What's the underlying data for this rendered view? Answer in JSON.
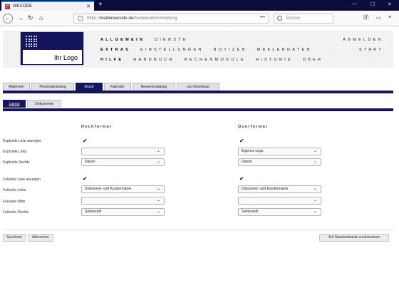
{
  "browser": {
    "tab_title": "WECODE",
    "tab_close": "✕",
    "new_tab": "+",
    "win_min": "—",
    "win_max": "☐",
    "win_close": "✕",
    "back": "←",
    "forward": "→",
    "reload": "↻",
    "home": "⌂",
    "url_prefix": "https://",
    "url_domain": "maklerwecode.de",
    "url_path": "/framework/Anmeldung",
    "url_more": "•••",
    "search_placeholder": "Suchen",
    "library": "|||\\",
    "sidebar": "▭",
    "menu": "≡",
    "icons": {
      "back": "back-arrow-icon",
      "forward": "forward-arrow-icon",
      "reload": "reload-icon",
      "home": "home-icon",
      "search": "search-icon",
      "info": "info-icon"
    }
  },
  "header": {
    "logo_text": "Ihr Logo",
    "menu": [
      {
        "title": "ALLGEMEIN",
        "items": [
          "DIENSTE"
        ],
        "right": "ABMELDEN"
      },
      {
        "title": "EXTRAS",
        "items": [
          "EINSTELLUNGEN",
          "NOTIZEN",
          "MAKLERDATEN"
        ],
        "right": "START"
      },
      {
        "title": "HILFE",
        "items": [
          "HANDBUCH",
          "RECHENMODULE",
          "HISTORIE",
          "ÜBER"
        ],
        "right": ""
      }
    ]
  },
  "tabs": [
    "Allgemein",
    "Personalisierung",
    "Druck",
    "Kalender",
    "Newsverwaltung",
    "Up-/Download"
  ],
  "active_tab": "Druck",
  "subtabs": [
    "Layout",
    "Dokumente"
  ],
  "active_subtab": "Layout",
  "form": {
    "col_hochformat": "Hochformat",
    "col_querformat": "Querformat",
    "rows": {
      "kopf_check": "Kopfzeile Linie anzeigen",
      "kopf_links": "Kopfzeile Links",
      "kopf_rechts": "Kopfzeile Rechts",
      "fuss_check": "Fußzeile Linie anzeigen",
      "fuss_links": "Fußzeile Links",
      "fuss_mitte": "Fußzeile Mitte",
      "fuss_rechts": "Fußzeile Rechts"
    },
    "hoch": {
      "kopf_check": "✔",
      "kopf_links": "",
      "kopf_rechts": "Datum",
      "fuss_check": "✔",
      "fuss_links": "Dokument- und Kundenname",
      "fuss_mitte": "",
      "fuss_rechts": "Seitenzahl"
    },
    "quer": {
      "kopf_check": "✔",
      "kopf_links": "Eigenes Logo",
      "kopf_rechts": "Datum",
      "fuss_check": "✔",
      "fuss_links": "Dokument- und Kundenname",
      "fuss_mitte": "",
      "fuss_rechts": "Seitenzahl"
    },
    "chevron": "⌄"
  },
  "buttons": {
    "save": "Speichern",
    "cancel": "Abbrechen",
    "reset": "Auf Standardwerte zurücksetzen"
  },
  "colors": {
    "brand": "#14145f",
    "tabstrip": "#0c0c3a",
    "accent": "#0a84ff"
  }
}
